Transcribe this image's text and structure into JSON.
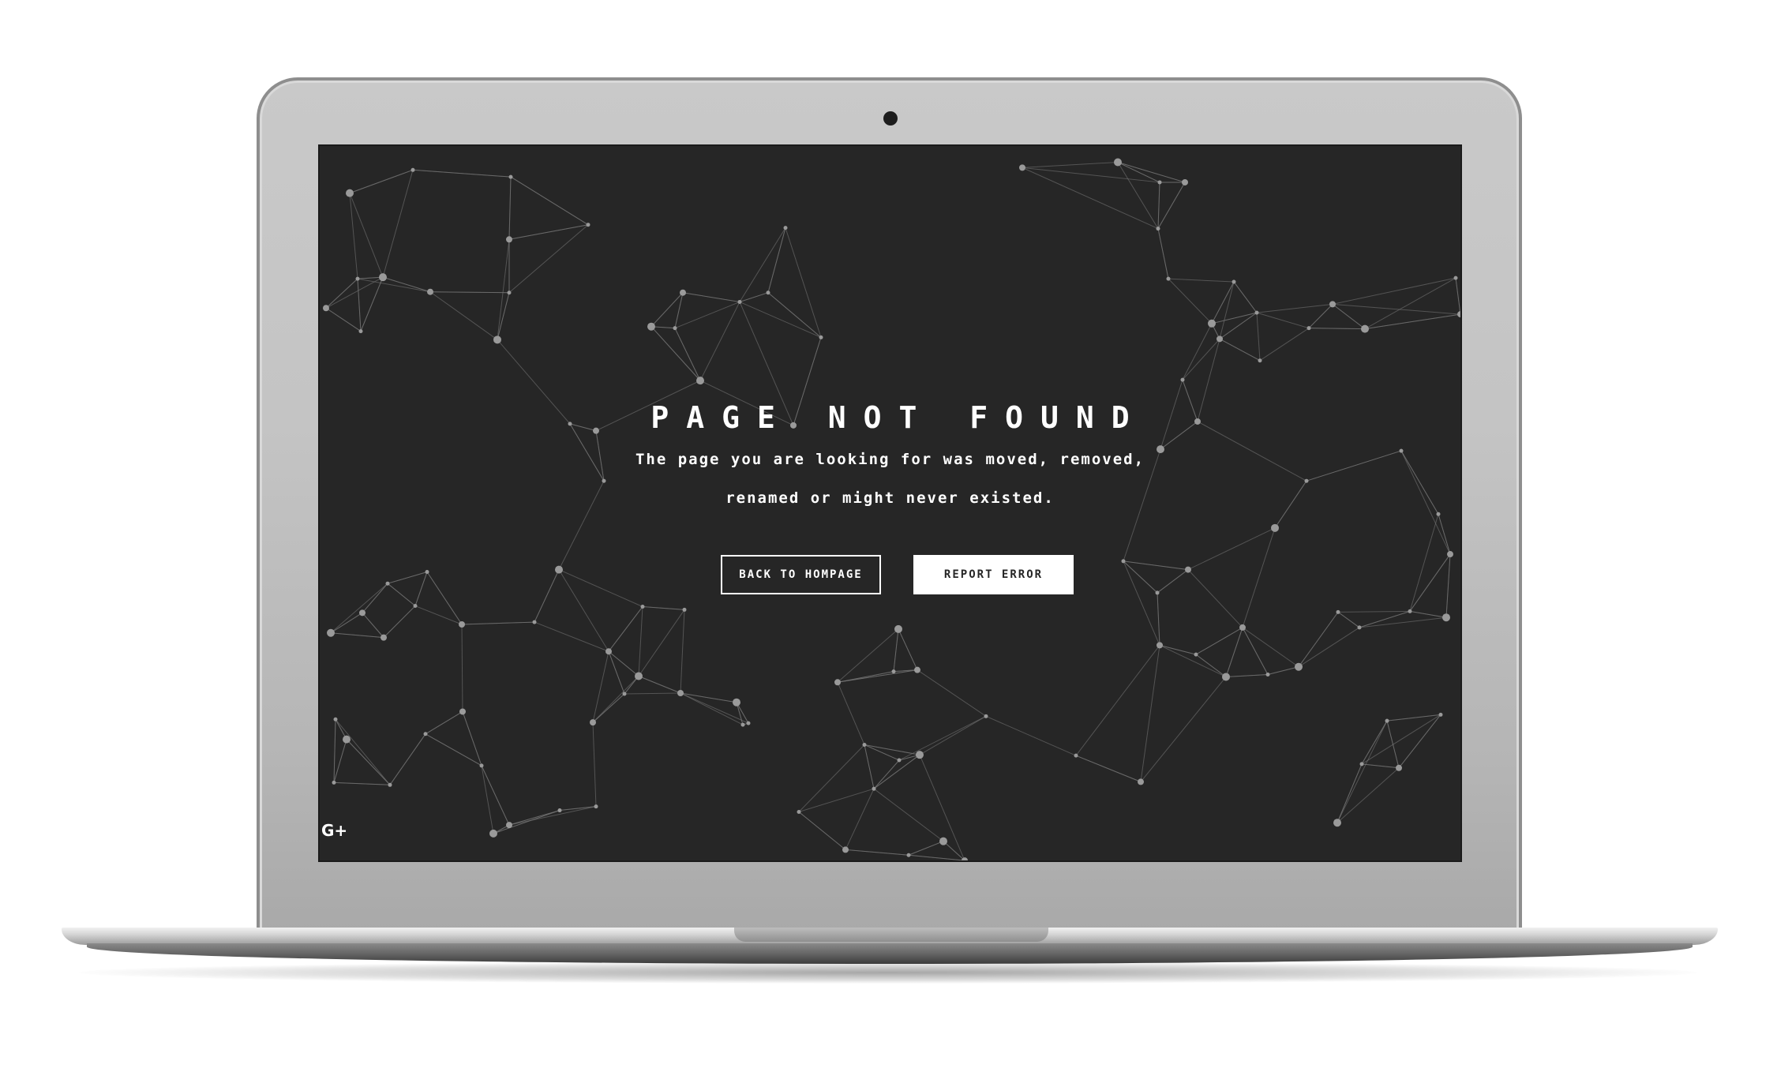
{
  "error_page": {
    "title": "PAGE NOT FOUND",
    "message_line1": "The page you are looking for was moved, removed,",
    "message_line2": "renamed or might never existed.",
    "buttons": {
      "home": "BACK TO HOMPAGE",
      "report": "REPORT ERROR"
    },
    "social": {
      "gplus": "G+"
    }
  },
  "colors": {
    "screen_background": "#262626",
    "text": "#ffffff",
    "network_lines": "#7a7a7a",
    "network_nodes": "#9a9a9a"
  },
  "icons": [
    "camera-icon",
    "gplus-icon"
  ]
}
